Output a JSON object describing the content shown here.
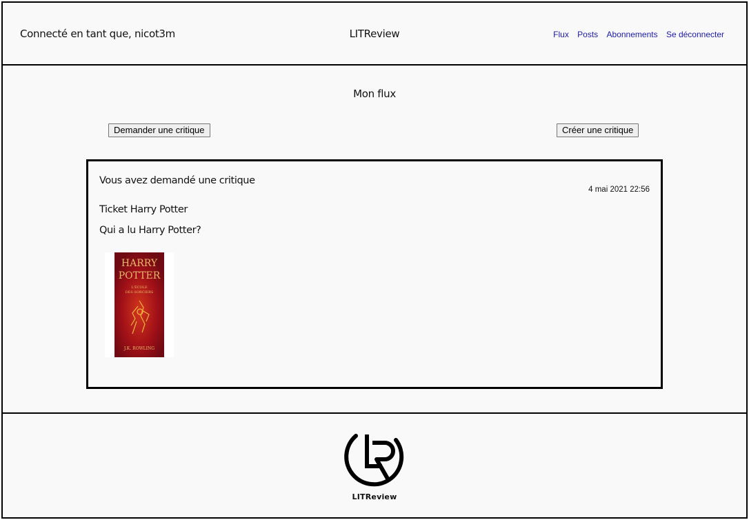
{
  "header": {
    "user_text": "Connecté en tant que, nicot3m",
    "brand": "LITReview",
    "nav": [
      {
        "label": "Flux"
      },
      {
        "label": "Posts"
      },
      {
        "label": "Abonnements"
      },
      {
        "label": "Se déconnecter"
      }
    ]
  },
  "main": {
    "title": "Mon flux",
    "request_review_button": "Demander une critique",
    "create_review_button": "Créer une critique",
    "ticket": {
      "heading": "Vous avez demandé une critique",
      "date": "4 mai 2021 22:56",
      "title": "Ticket Harry Potter",
      "description": "Qui a lu Harry Potter?",
      "cover": {
        "title_line1": "HARRY",
        "title_line2": "POTTER",
        "subtitle_line1": "L'ÉCOLE",
        "subtitle_line2": "DES SORCIERS",
        "author": "J.K. ROWLING"
      }
    }
  },
  "footer": {
    "logo_text": "LITReview"
  },
  "colors": {
    "link": "#1a1aa6",
    "background": "#f9f9f9",
    "cover_red": "#a11018"
  }
}
